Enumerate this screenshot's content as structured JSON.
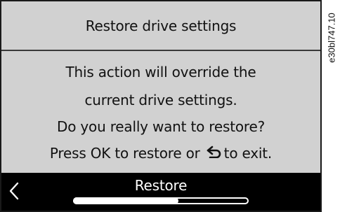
{
  "header": {
    "title": "Restore drive settings"
  },
  "message": {
    "line1": "This action will override the",
    "line2": "current drive settings.",
    "line3": "Do you really want to restore?",
    "line4_before": "Press OK to restore or",
    "line4_after": "to exit.",
    "inline_icon": "back-arrow-icon"
  },
  "footer": {
    "label": "Restore",
    "left_icon": "chevron-left-icon",
    "scroll_position": 0.6
  },
  "side_code": "e30bl747.10",
  "colors": {
    "screen_background": "#d1d1d1",
    "footer_background": "#000000",
    "text": "#111111",
    "footer_text": "#ffffff"
  }
}
